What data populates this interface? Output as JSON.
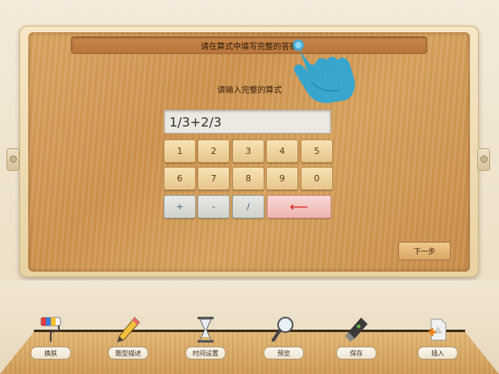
{
  "header": {
    "prompt": "请在算式中填写完整的答案"
  },
  "main": {
    "subtitle": "请输入完整的算式",
    "expression_value": "1/3+2/3",
    "keypad": {
      "row1": [
        "1",
        "2",
        "3",
        "4",
        "5"
      ],
      "row2": [
        "6",
        "7",
        "8",
        "9",
        "0"
      ],
      "ops": [
        "+",
        "-",
        "/"
      ],
      "backspace": "⟵"
    },
    "next_label": "下一步"
  },
  "toolbar": {
    "items": [
      {
        "label": "换肤",
        "icon": "paint-roller-icon"
      },
      {
        "label": "题型描述",
        "icon": "pencil-icon"
      },
      {
        "label": "时间设置",
        "icon": "hourglass-icon"
      },
      {
        "label": "预览",
        "icon": "magnifier-icon"
      },
      {
        "label": "保存",
        "icon": "usb-drive-icon"
      },
      {
        "label": "插入",
        "icon": "insert-document-icon"
      }
    ]
  },
  "colors": {
    "wood": "#d39c58",
    "backspace_arrow": "#d02020",
    "operator_text": "#3c5a80",
    "hand": "#2aa6d6"
  }
}
